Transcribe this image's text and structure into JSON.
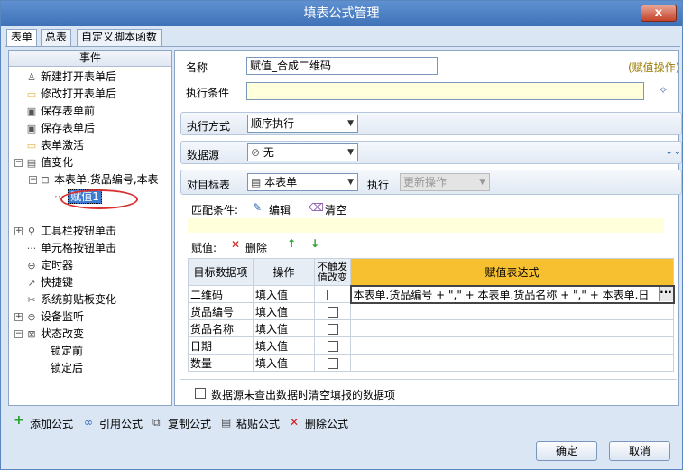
{
  "window": {
    "title": "填表公式管理",
    "close_glyph": "x"
  },
  "tabs": [
    {
      "label": "表单"
    },
    {
      "label": "总表"
    },
    {
      "label": "自定义脚本函数"
    }
  ],
  "tree": {
    "header": "事件",
    "items": [
      {
        "label": "新建打开表单后",
        "icon": "user-icon"
      },
      {
        "label": "修改打开表单后",
        "icon": "folder-icon"
      },
      {
        "label": "保存表单前",
        "icon": "save-icon"
      },
      {
        "label": "保存表单后",
        "icon": "save-icon"
      },
      {
        "label": "表单激活",
        "icon": "folder-icon"
      },
      {
        "label": "值变化",
        "icon": "document-icon"
      },
      {
        "label": "本表单.货品编号,本表",
        "icon": "table-icon"
      },
      {
        "label": "赋值1",
        "icon": "dotted-icon"
      },
      {
        "label": "工具栏按钮单击",
        "icon": "search-icon"
      },
      {
        "label": "单元格按钮单击",
        "icon": "dots-icon"
      },
      {
        "label": "定时器",
        "icon": "timer-icon"
      },
      {
        "label": "快捷键",
        "icon": "shortcut-icon"
      },
      {
        "label": "系统剪贴板变化",
        "icon": "scissors-icon"
      },
      {
        "label": "设备监听",
        "icon": "device-icon"
      },
      {
        "label": "状态改变",
        "icon": "state-icon"
      },
      {
        "label": "锁定前",
        "icon": ""
      },
      {
        "label": "锁定后",
        "icon": ""
      }
    ]
  },
  "form": {
    "name_label": "名称",
    "name_value": "赋值_合成二维码",
    "op_tag": "(赋值操作)",
    "cond_label": "执行条件",
    "cond_value": "",
    "exec_mode_label": "执行方式",
    "exec_mode_value": "顺序执行",
    "datasource_label": "数据源",
    "datasource_value": "无",
    "target_label": "对目标表",
    "target_value": "本表单",
    "exec_label": "执行",
    "exec_value": "更新操作",
    "match_label": "匹配条件:",
    "edit_label": "编辑",
    "clear_label": "清空",
    "assign_label": "赋值:",
    "delete_label": "删除"
  },
  "grid": {
    "headers": [
      "目标数据项",
      "操作",
      "不触发值改变",
      "赋值表达式"
    ],
    "rows": [
      {
        "target": "二维码",
        "op": "填入值",
        "expr": "本表单.货品编号 + \",\" + 本表单.货品名称 + \",\" + 本表单.日"
      },
      {
        "target": "货品编号",
        "op": "填入值",
        "expr": ""
      },
      {
        "target": "货品名称",
        "op": "填入值",
        "expr": ""
      },
      {
        "target": "日期",
        "op": "填入值",
        "expr": ""
      },
      {
        "target": "数量",
        "op": "填入值",
        "expr": ""
      }
    ]
  },
  "clear_on_empty_label": "数据源未查出数据时清空填报的数据项",
  "actions": [
    {
      "label": "添加公式"
    },
    {
      "label": "引用公式"
    },
    {
      "label": "复制公式"
    },
    {
      "label": "粘贴公式"
    },
    {
      "label": "删除公式"
    }
  ],
  "footer": {
    "ok": "确定",
    "cancel": "取消"
  },
  "colors": {
    "accent": "#3b7bd1",
    "header_expr": "#f7c030",
    "delete_red": "#d01818",
    "add_green": "#27a12e"
  }
}
